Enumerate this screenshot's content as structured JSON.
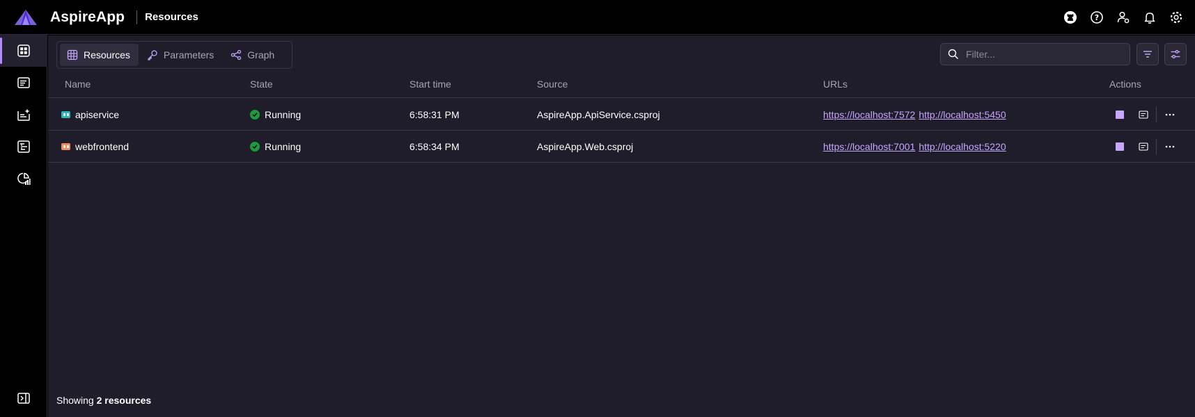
{
  "header": {
    "app_name": "AspireApp",
    "page_name": "Resources",
    "icons": [
      "github-icon",
      "help-icon",
      "user-settings-icon",
      "notifications-icon",
      "settings-icon"
    ]
  },
  "sidebar": {
    "items": [
      {
        "name": "resources",
        "icon": "grid-icon",
        "active": true
      },
      {
        "name": "console-logs",
        "icon": "console-icon",
        "active": false
      },
      {
        "name": "structured-logs",
        "icon": "structured-logs-icon",
        "active": false
      },
      {
        "name": "traces",
        "icon": "traces-icon",
        "active": false
      },
      {
        "name": "metrics",
        "icon": "metrics-icon",
        "active": false
      }
    ],
    "collapse_icon": "collapse-panel-icon"
  },
  "tabs": [
    {
      "label": "Resources",
      "icon": "table-icon",
      "active": true
    },
    {
      "label": "Parameters",
      "icon": "key-icon",
      "active": false
    },
    {
      "label": "Graph",
      "icon": "graph-icon",
      "active": false
    }
  ],
  "filter": {
    "placeholder": "Filter..."
  },
  "table": {
    "columns": [
      "Name",
      "State",
      "Start time",
      "Source",
      "URLs",
      "Actions"
    ],
    "rows": [
      {
        "name": "apiservice",
        "icon_color": "#2bb3b8",
        "state": "Running",
        "start_time": "6:58:31 PM",
        "source": "AspireApp.ApiService.csproj",
        "urls": [
          "https://localhost:7572",
          "http://localhost:5450"
        ]
      },
      {
        "name": "webfrontend",
        "icon_color": "#f08a5d",
        "state": "Running",
        "start_time": "6:58:34 PM",
        "source": "AspireApp.Web.csproj",
        "urls": [
          "https://localhost:7001",
          "http://localhost:5220"
        ]
      }
    ]
  },
  "footer": {
    "prefix": "Showing ",
    "count": "2 resources"
  },
  "colors": {
    "accent": "#c7a6ff",
    "running": "#1d9a3a",
    "background": "#1f1d2a"
  }
}
